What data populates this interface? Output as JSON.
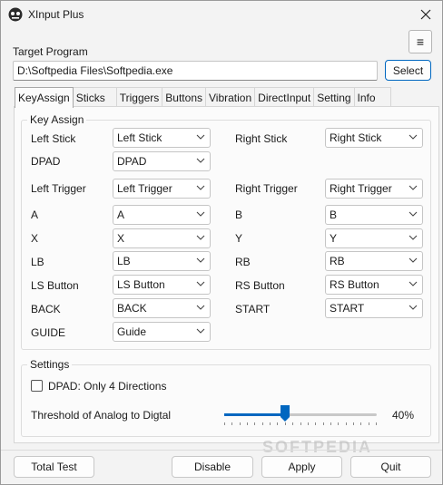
{
  "window": {
    "title": "XInput Plus"
  },
  "target": {
    "label": "Target Program",
    "path": "D:\\Softpedia Files\\Softpedia.exe",
    "select_label": "Select",
    "menu_glyph": "≡"
  },
  "tabs": [
    "KeyAssign",
    "Sticks",
    "Triggers",
    "Buttons",
    "Vibration",
    "DirectInput",
    "Setting",
    "Info"
  ],
  "key_assign": {
    "group_title": "Key Assign",
    "rows": [
      {
        "left_label": "Left Stick",
        "left_value": "Left Stick",
        "right_label": "Right Stick",
        "right_value": "Right Stick"
      },
      {
        "left_label": "DPAD",
        "left_value": "DPAD"
      },
      {
        "left_label": "Left Trigger",
        "left_value": "Left Trigger",
        "right_label": "Right Trigger",
        "right_value": "Right Trigger"
      },
      {
        "left_label": "A",
        "left_value": "A",
        "right_label": "B",
        "right_value": "B"
      },
      {
        "left_label": "X",
        "left_value": "X",
        "right_label": "Y",
        "right_value": "Y"
      },
      {
        "left_label": "LB",
        "left_value": "LB",
        "right_label": "RB",
        "right_value": "RB"
      },
      {
        "left_label": "LS Button",
        "left_value": "LS Button",
        "right_label": "RS Button",
        "right_value": "RS Button"
      },
      {
        "left_label": "BACK",
        "left_value": "BACK",
        "right_label": "START",
        "right_value": "START"
      },
      {
        "left_label": "GUIDE",
        "left_value": "Guide"
      }
    ]
  },
  "settings": {
    "group_title": "Settings",
    "dpad_checkbox_label": "DPAD: Only 4 Directions",
    "dpad_checked": false,
    "threshold_label": "Threshold of Analog to Digtal",
    "threshold_value": 40,
    "threshold_text": "40%"
  },
  "footer": {
    "total_test": "Total Test",
    "disable": "Disable",
    "apply": "Apply",
    "quit": "Quit"
  },
  "watermark": "SOFTPEDIA",
  "colors": {
    "accent": "#0067c0"
  }
}
